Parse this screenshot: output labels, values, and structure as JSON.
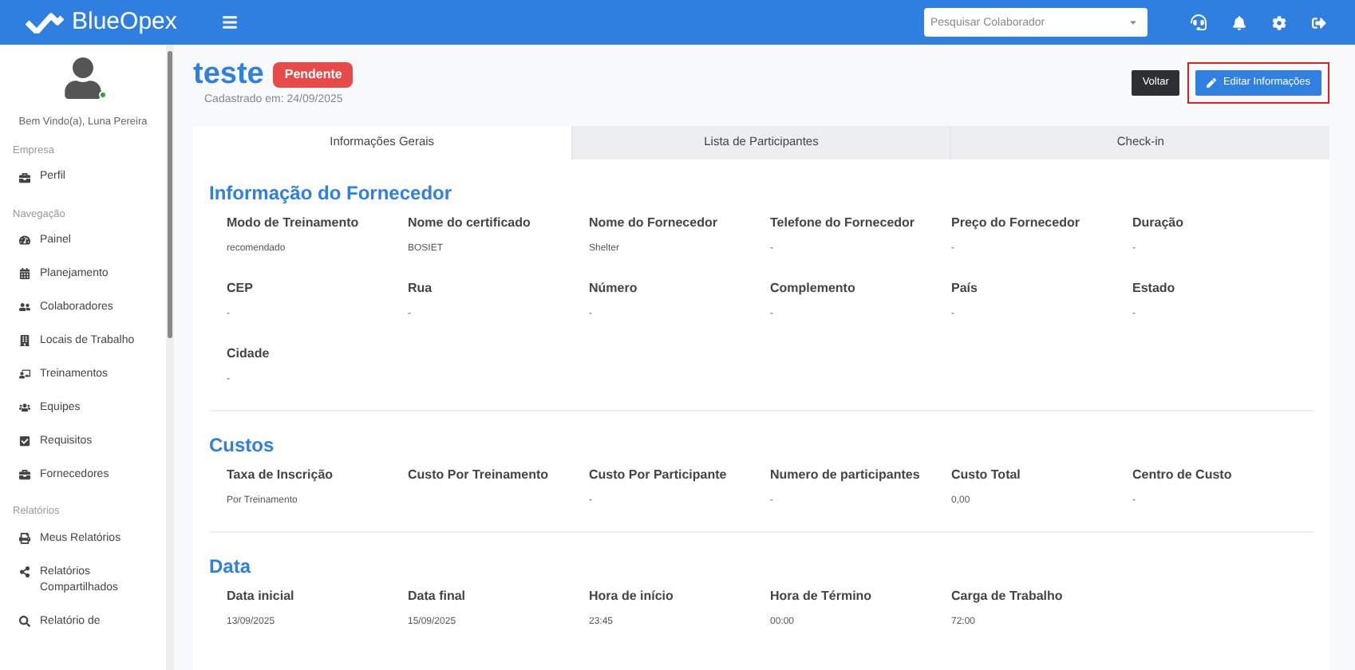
{
  "header": {
    "brand": "BlueOpex",
    "search": {
      "placeholder": "Pesquisar Colaborador"
    }
  },
  "sidebar": {
    "user": "Bem Vindo(a), Luna Pereira",
    "online": true,
    "groups": [
      {
        "title": "Empresa",
        "items": [
          {
            "label": "Perfil"
          }
        ]
      },
      {
        "title": "Navegação",
        "items": [
          {
            "label": "Painel"
          },
          {
            "label": "Planejamento"
          },
          {
            "label": "Colaboradores"
          },
          {
            "label": "Locais de Trabalho"
          },
          {
            "label": "Treinamentos"
          },
          {
            "label": "Equipes"
          },
          {
            "label": "Requisitos"
          },
          {
            "label": "Fornecedores"
          }
        ]
      },
      {
        "title": "Relatórios",
        "items": [
          {
            "label": "Meus Relatórios"
          },
          {
            "label": "Relatórios Compartilhados"
          },
          {
            "label": "Relatório de"
          }
        ]
      }
    ]
  },
  "page": {
    "title": "teste",
    "status": "Pendente",
    "subtitle": "Cadastrado em: 24/09/2025",
    "buttons": [
      {
        "label": "Voltar",
        "kind": "dark",
        "highlighted": false
      },
      {
        "label": "Editar Informações",
        "kind": "primary",
        "highlighted": true
      }
    ]
  },
  "tabs": [
    {
      "label": "Informações Gerais",
      "selected": true
    },
    {
      "label": "Lista de Participantes",
      "selected": false
    },
    {
      "label": "Check-in",
      "selected": false
    }
  ],
  "sections": [
    {
      "title": "Informação do Fornecedor",
      "fields": [
        {
          "label": "Modo de Treinamento",
          "value": "recomendado"
        },
        {
          "label": "Nome do certificado",
          "value": "BOSIET"
        },
        {
          "label": "Nome do Fornecedor",
          "value": "Shelter"
        },
        {
          "label": "Telefone do Fornecedor",
          "value": "-"
        },
        {
          "label": "Preço do Fornecedor",
          "value": "-"
        },
        {
          "label": "Duração",
          "value": "-"
        },
        {
          "label": "CEP",
          "value": "-"
        },
        {
          "label": "Rua",
          "value": "-"
        },
        {
          "label": "Número",
          "value": "-"
        },
        {
          "label": "Complemento",
          "value": "-"
        },
        {
          "label": "País",
          "value": "-"
        },
        {
          "label": "Estado",
          "value": "-"
        },
        {
          "label": "Cidade",
          "value": "-"
        }
      ]
    },
    {
      "title": "Custos",
      "fields": [
        {
          "label": "Taxa de Inscrição",
          "value": "Por Treinamento"
        },
        {
          "label": "Custo Por Treinamento"
        },
        {
          "label": "Custo Por Participante",
          "value": "-"
        },
        {
          "label": "Numero de participantes",
          "value": "-"
        },
        {
          "label": "Custo Total",
          "value": "0,00"
        },
        {
          "label": "Centro de Custo",
          "value": "-"
        }
      ]
    },
    {
      "title": "Data",
      "fields": [
        {
          "label": "Data inicial",
          "value": "13/09/2025"
        },
        {
          "label": "Data final",
          "value": "15/09/2025"
        },
        {
          "label": "Hora de início",
          "value": "23:45"
        },
        {
          "label": "Hora de Término",
          "value": "00:00"
        },
        {
          "label": "Carga de Trabalho",
          "value": "72:00"
        }
      ]
    }
  ]
}
